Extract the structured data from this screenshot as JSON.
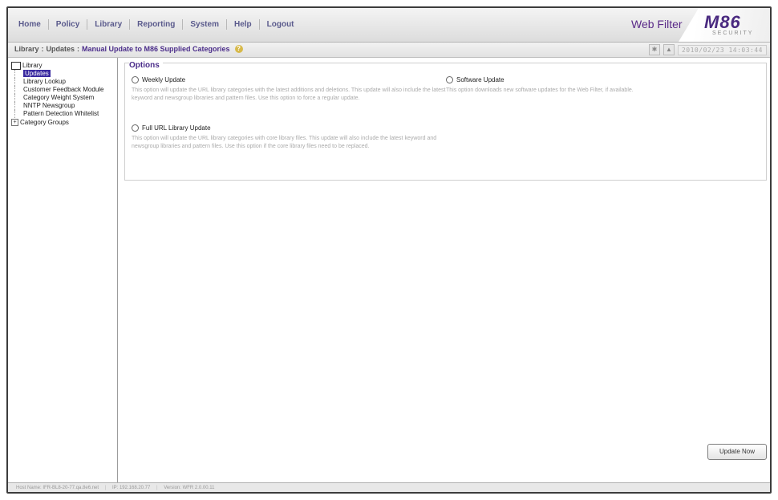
{
  "nav": {
    "items": [
      "Home",
      "Policy",
      "Library",
      "Reporting",
      "System",
      "Help",
      "Logout"
    ]
  },
  "brand": {
    "product": "Web Filter",
    "logo": "M86",
    "logo_sub": "SECURITY"
  },
  "breadcrumb": {
    "parts": [
      "Library",
      "Updates"
    ],
    "separator": ":",
    "current": "Manual Update to M86 Supplied Categories",
    "datetime": "2010/02/23 14:03:44"
  },
  "sidebar": {
    "root": "Library",
    "items": [
      "Updates",
      "Library Lookup",
      "Customer Feedback Module",
      "Category Weight System",
      "NNTP Newsgroup",
      "Pattern Detection Whitelist"
    ],
    "group": "Category Groups",
    "selected_index": 0
  },
  "options": {
    "title": "Options",
    "weekly": {
      "label": "Weekly Update",
      "desc": "This option will update the URL library categories with the latest additions and deletions. This update will also include the latest keyword and newsgroup libraries and pattern files. Use this option to force a regular update."
    },
    "full": {
      "label": "Full URL Library Update",
      "desc": "This option will update the URL library categories with core library files. This update will also include the latest keyword and newsgroup libraries and pattern files. Use this option if the core library files need to be replaced."
    },
    "software": {
      "label": "Software Update",
      "desc": "This option downloads new software updates for the Web Filter, if available."
    }
  },
  "buttons": {
    "update_now": "Update Now"
  },
  "status": {
    "host": "Host Name: IFR-BL8-20-77.qa.8e6.net",
    "ip": "IP: 192.168.20.77",
    "version": "Version: WFR 2.0.00.11"
  },
  "colors": {
    "accent": "#4b2d8a",
    "selection": "#3a2aa0",
    "nav_text": "#5a5a8c"
  }
}
